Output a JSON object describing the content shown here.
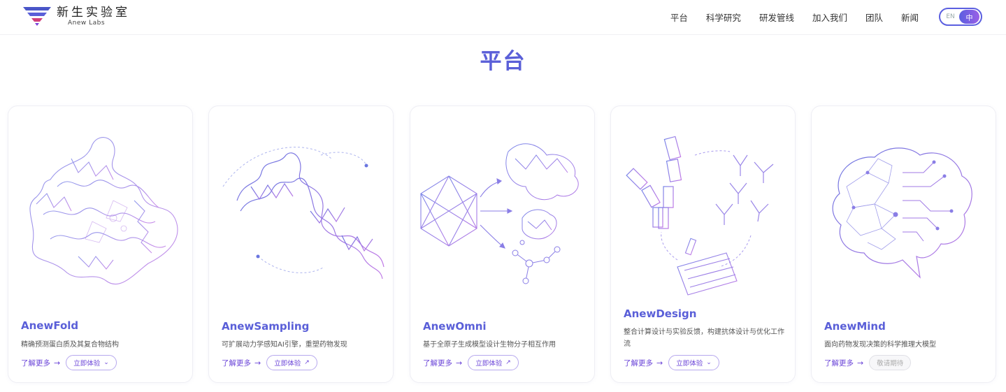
{
  "header": {
    "logo_cn": "新生实验室",
    "logo_en": "Anew Labs",
    "nav": [
      "平台",
      "科学研究",
      "研发管线",
      "加入我们",
      "团队",
      "新闻"
    ],
    "lang_en": "EN",
    "lang_zh": "中"
  },
  "page_title": "平台",
  "cards": [
    {
      "title": "AnewFold",
      "desc": "精确预测蛋白质及其复合物结构",
      "learn": "了解更多",
      "try": "立即体验",
      "try_icon": "chevron-down-icon"
    },
    {
      "title": "AnewSampling",
      "desc": "可扩展动力学感知AI引擎，重塑药物发现",
      "learn": "了解更多",
      "try": "立即体验",
      "try_icon": "external-arrow-icon"
    },
    {
      "title": "AnewOmni",
      "desc": "基于全原子生成模型设计生物分子相互作用",
      "learn": "了解更多",
      "try": "立即体验",
      "try_icon": "external-arrow-icon"
    },
    {
      "title": "AnewDesign",
      "desc": "整合计算设计与实验反馈，构建抗体设计与优化工作流",
      "learn": "了解更多",
      "try": "立即体验",
      "try_icon": "chevron-down-icon"
    },
    {
      "title": "AnewMind",
      "desc": "面向药物发现决策的科学推理大模型",
      "learn": "了解更多",
      "try": "敬请期待",
      "try_icon": ""
    }
  ],
  "colors": {
    "accent": "#5a5fd8",
    "purple": "#6b45d8",
    "lavender": "#b7a8ee"
  }
}
